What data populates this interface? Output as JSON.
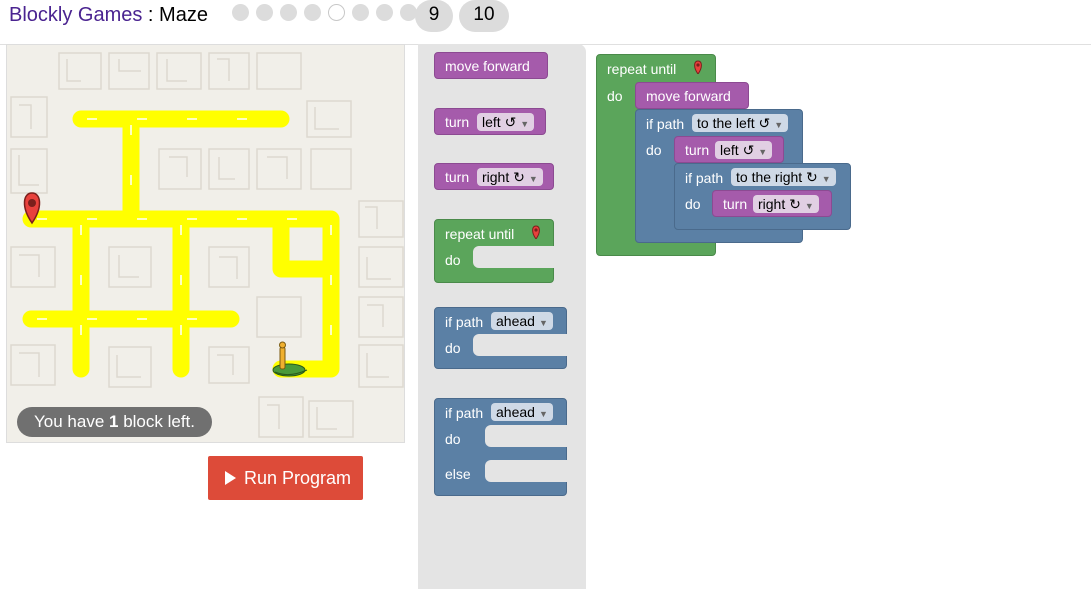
{
  "header": {
    "app_name": "Blockly Games",
    "separator": " : ",
    "game_name": "Maze",
    "levels": [
      "1",
      "2",
      "3",
      "4",
      "5",
      "6",
      "7",
      "8",
      "9",
      "10"
    ],
    "current_level": 5
  },
  "maze": {
    "capacity_prefix": "You have ",
    "capacity_count": "1",
    "capacity_suffix": " block left.",
    "wall_color": "#f1efe9",
    "path_color": "#ffff00",
    "start_icon": "red-marker-icon",
    "finish_icon": "pegman-icon"
  },
  "run_button": {
    "label": "Run Program",
    "icon": "play-icon",
    "color": "#dd4b39"
  },
  "toolbox": {
    "move_forward": "move forward",
    "turn_left": {
      "label": "turn",
      "dropdown": "left ↺"
    },
    "turn_right": {
      "label": "turn",
      "dropdown": "right ↻"
    },
    "repeat_until": {
      "label": "repeat until",
      "do": "do"
    },
    "if_path": {
      "label": "if path",
      "dropdown": "ahead",
      "do": "do"
    },
    "if_else": {
      "label": "if path",
      "dropdown": "ahead",
      "do": "do",
      "else": "else"
    }
  },
  "workspace": {
    "repeat_label": "repeat until",
    "repeat_do": "do",
    "move_forward": "move forward",
    "if1_label": "if path",
    "if1_dropdown": "to the left ↺",
    "if1_do": "do",
    "turn1_label": "turn",
    "turn1_dropdown": "left ↺",
    "if2_label": "if path",
    "if2_dropdown": "to the right ↻",
    "if2_do": "do",
    "turn2_label": "turn",
    "turn2_dropdown": "right ↻"
  },
  "colors": {
    "movement": "#a55bab",
    "loops": "#5ba55b",
    "logic": "#5b80a5"
  }
}
